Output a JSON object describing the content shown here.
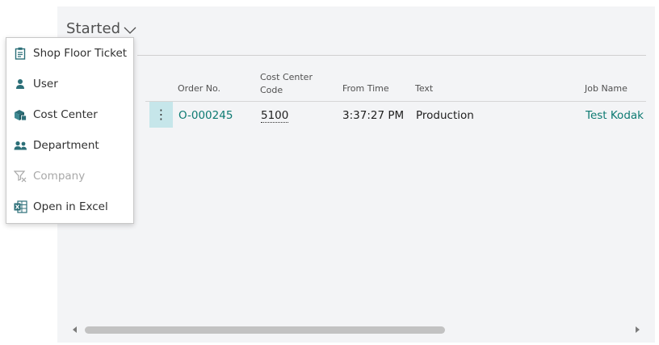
{
  "page": {
    "title": "Started"
  },
  "table": {
    "columns": {
      "order_no": "Order No.",
      "cost_center_line1": "Cost Center",
      "cost_center_line2": "Code",
      "from_time": "From Time",
      "text": "Text",
      "job_name": "Job Name"
    },
    "rows": [
      {
        "order_no": "O-000245",
        "cost_center_code": "5100",
        "from_time": "3:37:27 PM",
        "text": "Production",
        "job_name": "Test Kodak S"
      }
    ]
  },
  "context_menu": {
    "items": [
      {
        "label": "Shop Floor Ticket",
        "icon": "clipboard-icon",
        "enabled": true
      },
      {
        "label": "User",
        "icon": "user-icon",
        "enabled": true
      },
      {
        "label": "Cost Center",
        "icon": "cost-center-icon",
        "enabled": true
      },
      {
        "label": "Department",
        "icon": "people-icon",
        "enabled": true
      },
      {
        "label": "Company",
        "icon": "filter-clear-icon",
        "enabled": false
      },
      {
        "label": "Open in Excel",
        "icon": "excel-icon",
        "enabled": true
      }
    ]
  },
  "colors": {
    "accent": "#0d7a72",
    "row_menu_bg": "#c6e6ea",
    "panel_bg": "#f3f4f6"
  }
}
